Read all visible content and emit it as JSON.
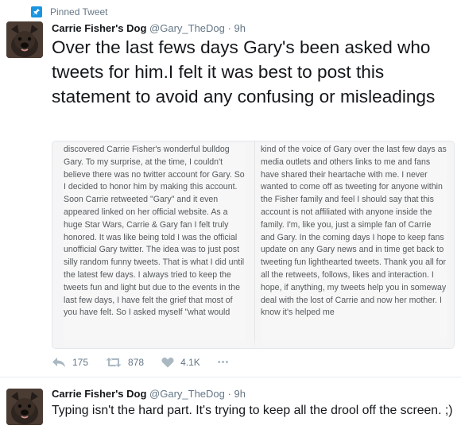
{
  "pinned": {
    "label": "Pinned Tweet",
    "icon": "pin-icon"
  },
  "tweets": [
    {
      "name": "Carrie Fisher's Dog",
      "handle": "@Gary_TheDog",
      "separator": "·",
      "time": "9h",
      "text": "Over the last fews days Gary's been asked who tweets for him.I felt it was best to post this statement to avoid any confusing or misleadings",
      "image_text": {
        "left": "discovered Carrie Fisher's wonderful bulldog Gary. To my surprise, at the time, I couldn't believe there was no twitter account for Gary. So I decided to honor him by making this account. Soon Carrie retweeted \"Gary\" and it even appeared linked on her official website. As a huge Star Wars, Carrie & Gary fan I felt truly honored. It was like being told I was the official unofficial Gary twitter. The idea was to just post silly random funny tweets. That is what I did until the latest few days. I always tried to keep the tweets fun and light but due to the events in the last few days, I have felt the grief that most of you have felt. So I asked myself \"what would",
        "right": "kind of the voice of Gary over the last few days as media outlets and others links to me and fans have shared their heartache with me. I never wanted to come off as tweeting for anyone within the Fisher family and feel I should say that this account is not affiliated with anyone inside the family. I'm, like you, just a simple fan of Carrie and Gary. In the coming days I hope to keep fans update on any Gary news and in time get back to tweeting fun lighthearted tweets. Thank you all for all the retweets, follows, likes and interaction. I hope, if anything, my tweets help you in someway deal with the lost of Carrie and now her mother. I know it's helped me"
      },
      "actions": {
        "reply": "175",
        "retweet": "878",
        "like": "4.1K",
        "more": "•••"
      }
    },
    {
      "name": "Carrie Fisher's Dog",
      "handle": "@Gary_TheDog",
      "separator": "·",
      "time": "9h",
      "text": "Typing isn't the hard part. It's trying to keep all the drool off the screen. ;)"
    }
  ],
  "colors": {
    "accent": "#1b95e0",
    "muted": "#657786",
    "icon": "#aab8c2"
  }
}
